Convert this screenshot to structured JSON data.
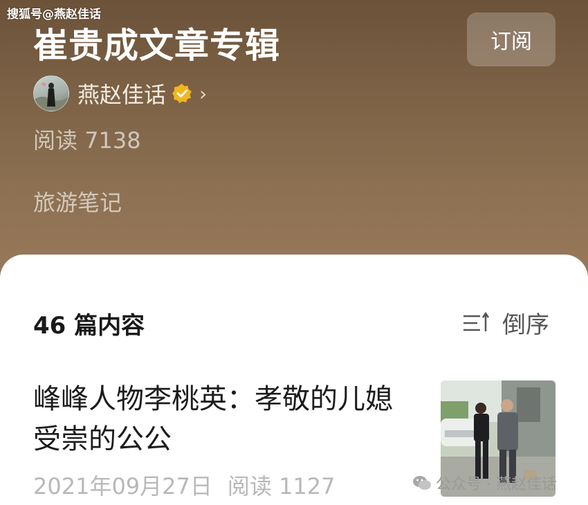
{
  "watermark_top": "搜狐号@燕赵佳话",
  "album": {
    "title": "崔贵成文章专辑",
    "subscribe_label": "订阅",
    "author": "燕赵佳话",
    "read_count": "阅读 7138",
    "category": "旅游笔记"
  },
  "content": {
    "count_label": "46 篇内容",
    "sort_label": "倒序"
  },
  "articles": [
    {
      "title": "峰峰人物李桃英：孝敬的儿媳 受崇的公公",
      "date": "2021年09月27日",
      "reads": "阅读 1127"
    }
  ],
  "watermark_bottom": "公众号 · 燕赵佳话",
  "colors": {
    "header_brown": "#7d6246",
    "verified_gold": "#f2b51f",
    "text_dark": "#1c1c1c",
    "text_meta": "#b8b8b8"
  },
  "icons": {
    "verified": "verified-badge-icon",
    "chevron": "chevron-right-icon",
    "sort": "sort-descending-icon",
    "wechat": "wechat-icon"
  }
}
